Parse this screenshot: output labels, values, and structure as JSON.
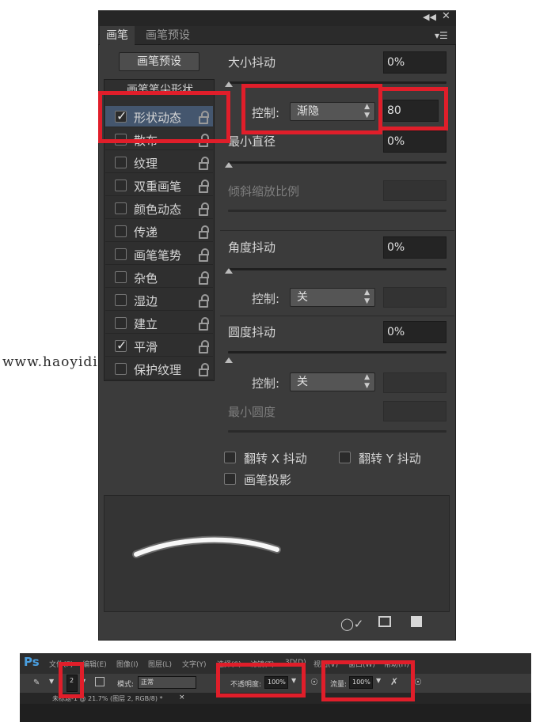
{
  "panel": {
    "collapse_icon": "double-left-arrow-icon",
    "close_icon": "close-icon",
    "menu_icon": "panel-menu-icon",
    "tabs": [
      {
        "label": "画笔"
      },
      {
        "label": "画笔预设"
      }
    ],
    "brush_presets_button": "画笔预设"
  },
  "sidebar": {
    "header_label": "画笔笔尖形状",
    "items": [
      {
        "label": "形状动态",
        "checked": true,
        "selected": true
      },
      {
        "label": "散布",
        "checked": false
      },
      {
        "label": "纹理",
        "checked": false
      },
      {
        "label": "双重画笔",
        "checked": false
      },
      {
        "label": "颜色动态",
        "checked": false
      },
      {
        "label": "传递",
        "checked": false
      },
      {
        "label": "画笔笔势",
        "checked": false
      },
      {
        "label": "杂色",
        "checked": false
      },
      {
        "label": "湿边",
        "checked": false
      },
      {
        "label": "建立",
        "checked": false
      },
      {
        "label": "平滑",
        "checked": true
      },
      {
        "label": "保护纹理",
        "checked": false
      }
    ],
    "check_glyph": "✓"
  },
  "settings": {
    "size_jitter": {
      "label": "大小抖动",
      "value": "0%"
    },
    "size_control": {
      "label": "控制:",
      "value": "渐隐",
      "steps": "80"
    },
    "min_diameter": {
      "label": "最小直径",
      "value": "0%"
    },
    "tilt_scale": {
      "label": "倾斜缩放比例"
    },
    "angle_jitter": {
      "label": "角度抖动",
      "value": "0%"
    },
    "angle_control": {
      "label": "控制:",
      "value": "关"
    },
    "roundness_jitter": {
      "label": "圆度抖动",
      "value": "0%"
    },
    "roundness_control": {
      "label": "控制:",
      "value": "关"
    },
    "min_roundness": {
      "label": "最小圆度"
    },
    "flip_x": {
      "label": "翻转 X 抖动"
    },
    "flip_y": {
      "label": "翻转 Y 抖动"
    },
    "brush_projection": {
      "label": "画笔投影"
    }
  },
  "footer_icons": [
    "brush-preview-toggle-icon",
    "grid-icon",
    "new-preset-icon"
  ],
  "watermark": "www.haoyidiansheji.com",
  "app": {
    "logo": "Ps",
    "menu": [
      "文件(F)",
      "编辑(E)",
      "图像(I)",
      "图层(L)",
      "文字(Y)",
      "选择(S)",
      "滤镜(T)",
      "3D(D)",
      "视图(V)",
      "窗口(W)",
      "帮助(H)"
    ],
    "options": {
      "brush_size": "2",
      "mode_label": "模式:",
      "mode_value": "正常",
      "opacity_label": "不透明度:",
      "opacity_value": "100%",
      "flow_label": "流量:",
      "flow_value": "100%"
    },
    "document_tab": "未标题-1 @ 21.7% (图层 2, RGB/8) *",
    "document_close": "×"
  },
  "colors": {
    "highlight": "#e01e2a",
    "selected_row": "#44566e"
  }
}
